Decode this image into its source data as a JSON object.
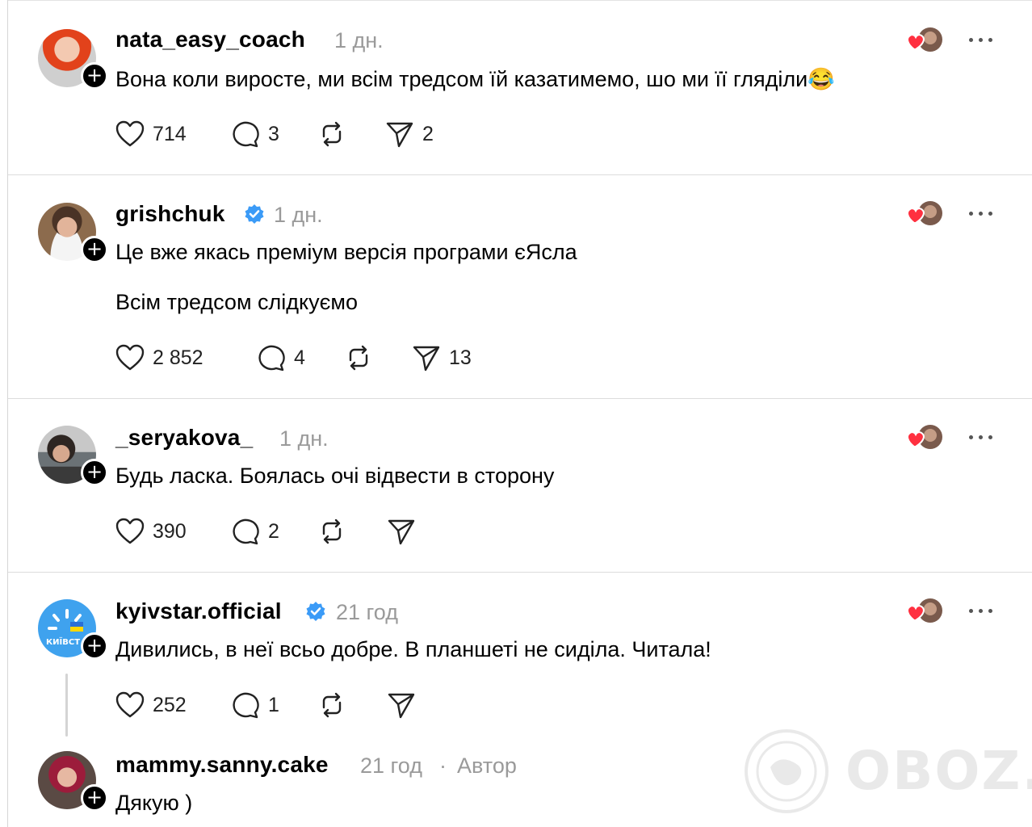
{
  "posts": [
    {
      "username": "nata_easy_coach",
      "time": "1 дн.",
      "lines": [
        "Вона коли виросте, ми всім тредсом їй казатимемо, шо ми її гляділи😂"
      ],
      "likes": "714",
      "replies": "3",
      "shares": "2",
      "verified": false
    },
    {
      "username": "grishchuk",
      "time": "1 дн.",
      "lines": [
        "Це вже якась преміум версія програми єЯсла",
        "Всім тредсом слідкуємо"
      ],
      "likes": "2 852",
      "replies": "4",
      "shares": "13",
      "verified": true
    },
    {
      "username": "_seryakova_",
      "time": "1 дн.",
      "lines": [
        "Будь ласка. Боялась очі відвести в сторону"
      ],
      "likes": "390",
      "replies": "2",
      "shares": "",
      "verified": false
    },
    {
      "username": "kyivstar.official",
      "time": "21 год",
      "lines": [
        "Дивились, в неї всьо добре. В планшеті не сиділа. Читала!"
      ],
      "likes": "252",
      "replies": "1",
      "shares": "",
      "verified": true,
      "avatar_text": "КИЇВСТ"
    },
    {
      "username": "mammy.sanny.cake",
      "time": "21 год",
      "separator": "·",
      "author_badge": "Автор",
      "lines": [
        "Дякую )"
      ],
      "verified": false
    }
  ],
  "watermark": "OBOZ.UA",
  "colors": {
    "verified": "#3b9bf7",
    "like_heart": "#ff3040",
    "muted": "#9a9a9a"
  },
  "icons": [
    "heart-icon",
    "comment-icon",
    "repost-icon",
    "send-icon",
    "more-icon",
    "plus-icon",
    "verified-icon"
  ]
}
